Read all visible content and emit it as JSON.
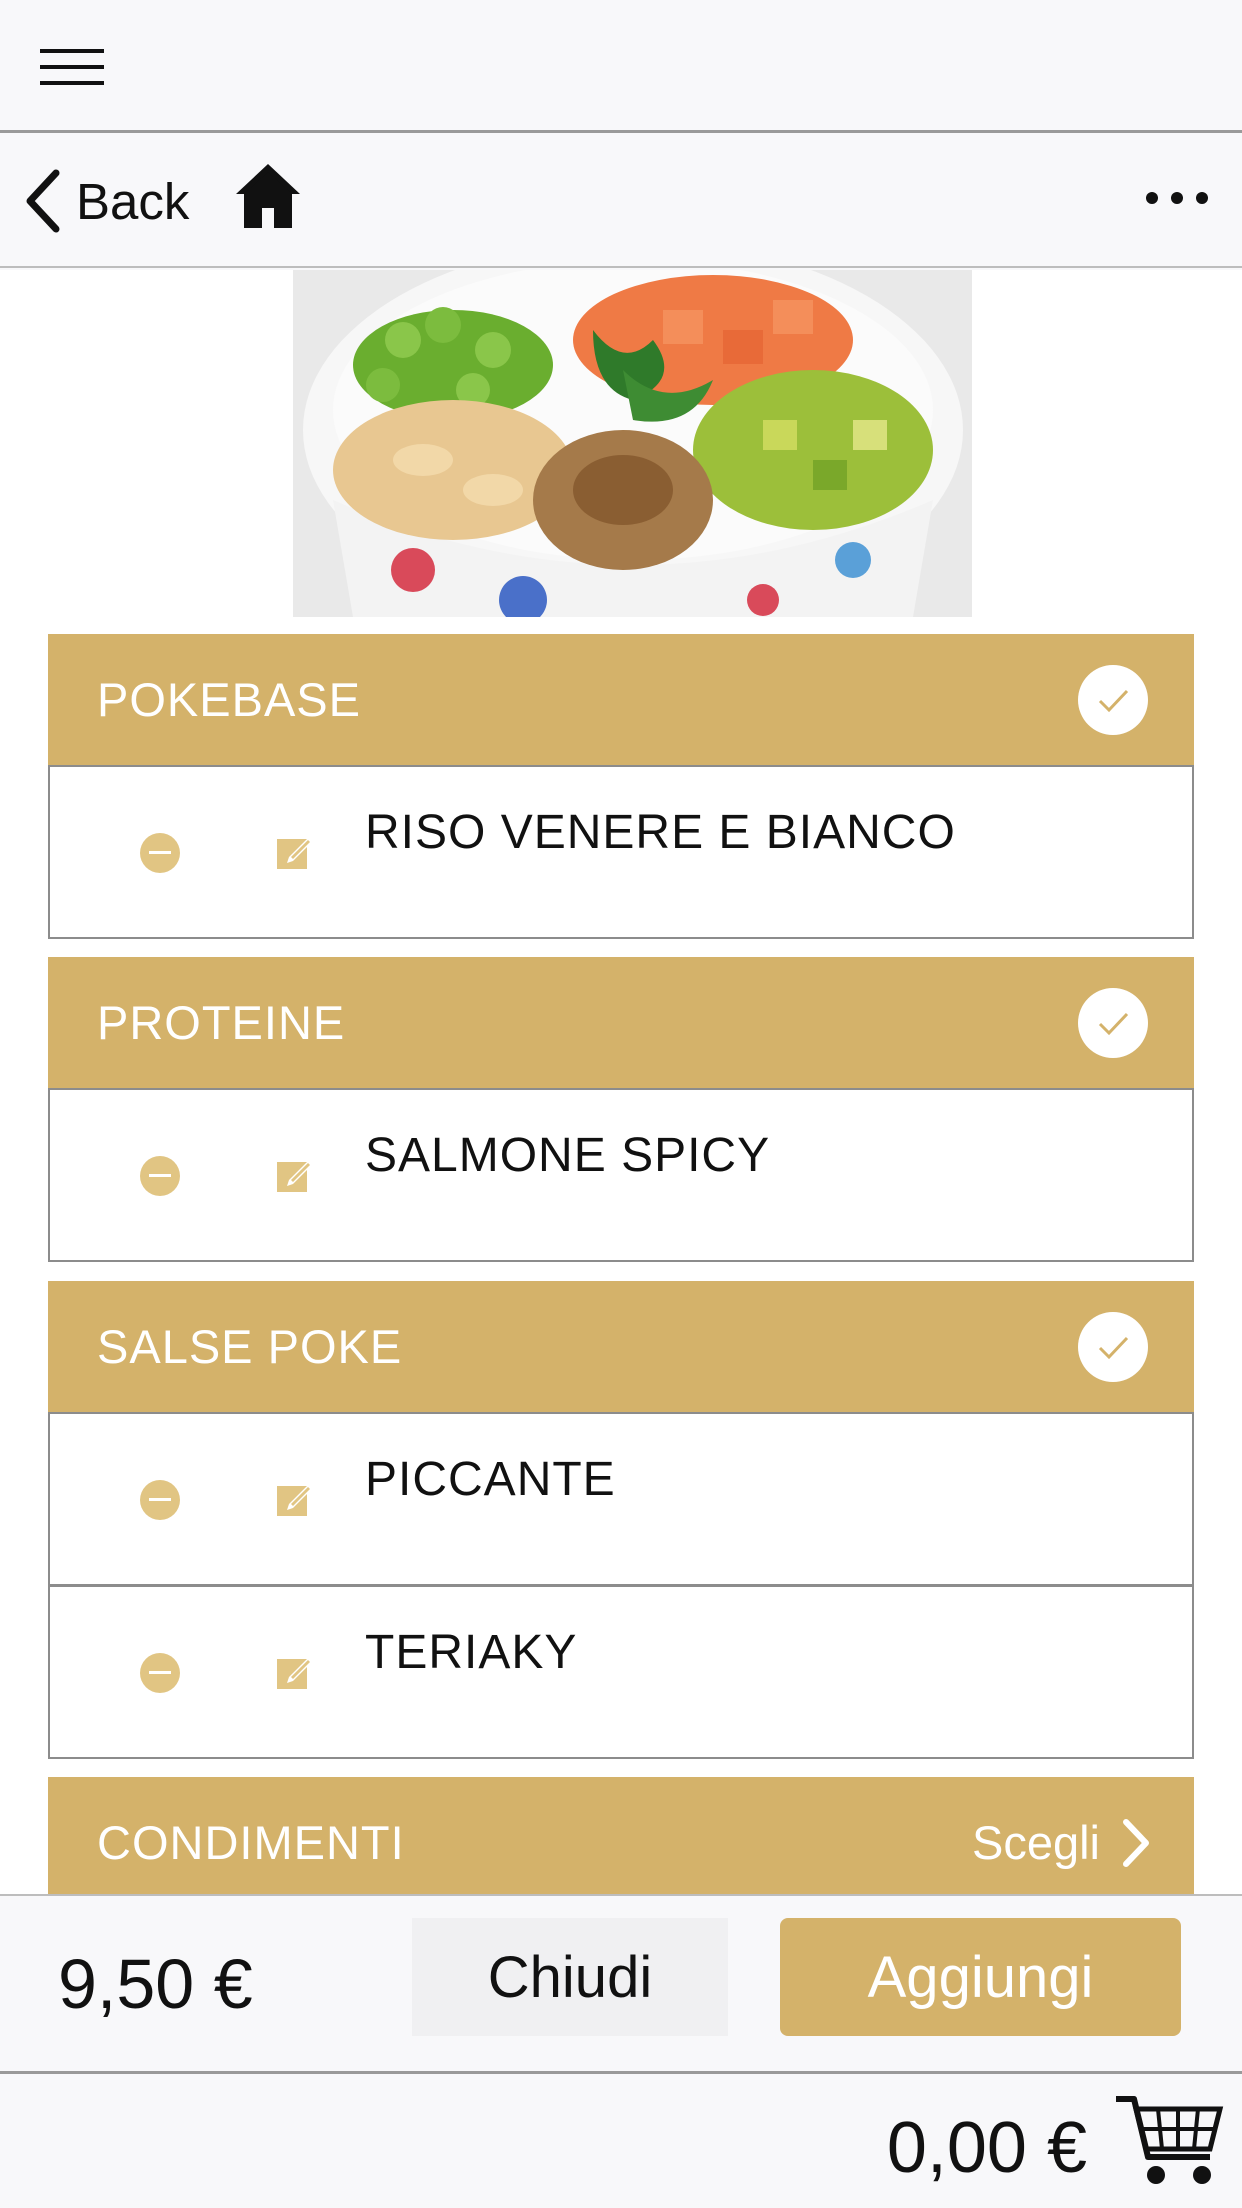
{
  "nav": {
    "back_label": "Back"
  },
  "sections": [
    {
      "title": "POKEBASE",
      "items": [
        "RISO VENERE E BIANCO"
      ]
    },
    {
      "title": "PROTEINE",
      "items": [
        "SALMONE SPICY"
      ]
    },
    {
      "title": "SALSE POKE",
      "items": [
        "PICCANTE",
        "TERIAKY"
      ]
    },
    {
      "title": "CONDIMENTI",
      "action": "Scegli"
    }
  ],
  "footer": {
    "price": "9,50 €",
    "close_label": "Chiudi",
    "add_label": "Aggiungi"
  },
  "cart": {
    "total": "0,00 €"
  },
  "colors": {
    "accent": "#d4b26a",
    "accent_light": "#e1c583"
  }
}
